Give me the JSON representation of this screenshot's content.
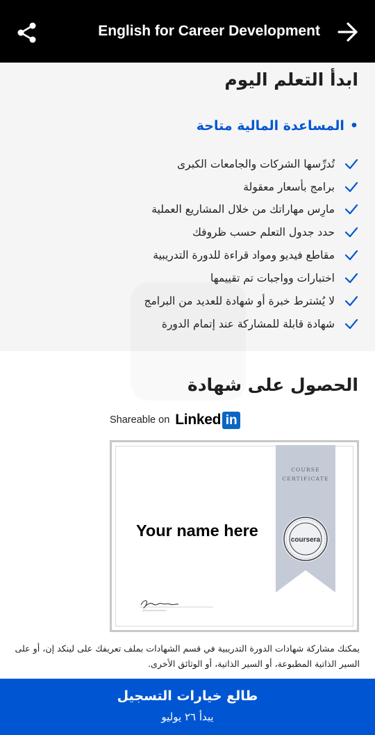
{
  "header": {
    "title": "English for Career Development",
    "share_icon": "share-icon",
    "back_icon": "arrow-right-icon"
  },
  "start": {
    "heading": "ابدأ التعلم اليوم",
    "financial_aid": "المساعدة المالية متاحة",
    "features": [
      "تُدرِّسها الشركات والجامعات الكبرى",
      "برامج بأسعار معقولة",
      "مارِس مهاراتك من خلال المشاريع العملية",
      "حدد جدول التعلم حسب ظروفك",
      "مقاطع فيديو ومواد قراءة للدورة التدريبية",
      "اختبارات وواجبات تم تقييمها",
      "لا يُشترط خبرة أو شهادة للعديد من البرامج",
      "شهادة قابلة للمشاركة عند إتمام الدورة"
    ]
  },
  "certificate": {
    "heading": "الحصول على شهادة",
    "shareable_on": "Shareable on",
    "linkedin_word": "Linked",
    "linkedin_box": "in",
    "ribbon_line1": "COURSE",
    "ribbon_line2": "CERTIFICATE",
    "seal_text": "coursera",
    "placeholder_name": "Your name here",
    "description": "يمكنك مشاركة شهادات الدورة التدريبية في قسم الشهادات بملف تعريفك على لينكد إن، أو على السير الذاتية المطبوعة، أو السير الذاتية، أو الوثائق الأخرى."
  },
  "enroll": {
    "title": "طالع خيارات التسجيل",
    "subtitle": "يبدأ ٢٦ يوليو"
  },
  "colors": {
    "accent": "#0056d2",
    "header_bg": "#000000",
    "section_bg": "#f5f5f5",
    "ribbon": "#c5cbd6"
  }
}
